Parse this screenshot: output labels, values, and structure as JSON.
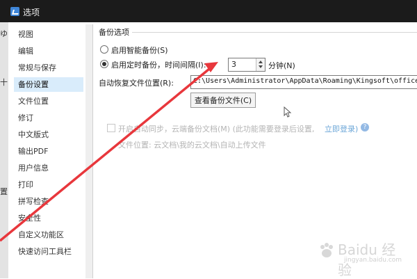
{
  "window": {
    "title": "选项"
  },
  "left_edge": {
    "fragments": [
      "ゆ",
      "十",
      "置"
    ]
  },
  "sidebar": {
    "items": [
      {
        "label": "视图"
      },
      {
        "label": "编辑"
      },
      {
        "label": "常规与保存"
      },
      {
        "label": "备份设置",
        "selected": true
      },
      {
        "label": "文件位置"
      },
      {
        "label": "修订"
      },
      {
        "label": "中文版式"
      },
      {
        "label": "输出PDF"
      },
      {
        "label": "用户信息"
      },
      {
        "label": "打印"
      },
      {
        "label": "拼写检查"
      },
      {
        "label": "安全性"
      },
      {
        "label": "自定义功能区"
      },
      {
        "label": "快速访问工具栏"
      }
    ]
  },
  "backup": {
    "group_title": "备份选项",
    "smart_backup": {
      "label": "启用智能备份(S)",
      "checked": false
    },
    "timed_backup": {
      "label": "启用定时备份，时间间隔(I):",
      "checked": true
    },
    "interval": {
      "value": "3",
      "unit": "分钟(N)"
    },
    "autorecover": {
      "label": "自动恢复文件位置(R):",
      "path": "C:\\Users\\Administrator\\AppData\\Roaming\\Kingsoft\\office6\\"
    },
    "view_backup_button": "查看备份文件(C)",
    "cloud_backup": {
      "label": "开启自动同步，云端备份文档(M) (此功能需要登录后设置,",
      "login_link": "立即登录)",
      "location": "文件位置: 云文档\\我的云文档\\自动上传文件",
      "checked": false
    }
  },
  "watermark": {
    "text": "Baidu 经验",
    "sub": "jingyan.baidu.com"
  },
  "colors": {
    "annotation_arrow": "#e8373c",
    "selected_item": "#d9ecfb",
    "titlebar": "#1b1b1b"
  }
}
